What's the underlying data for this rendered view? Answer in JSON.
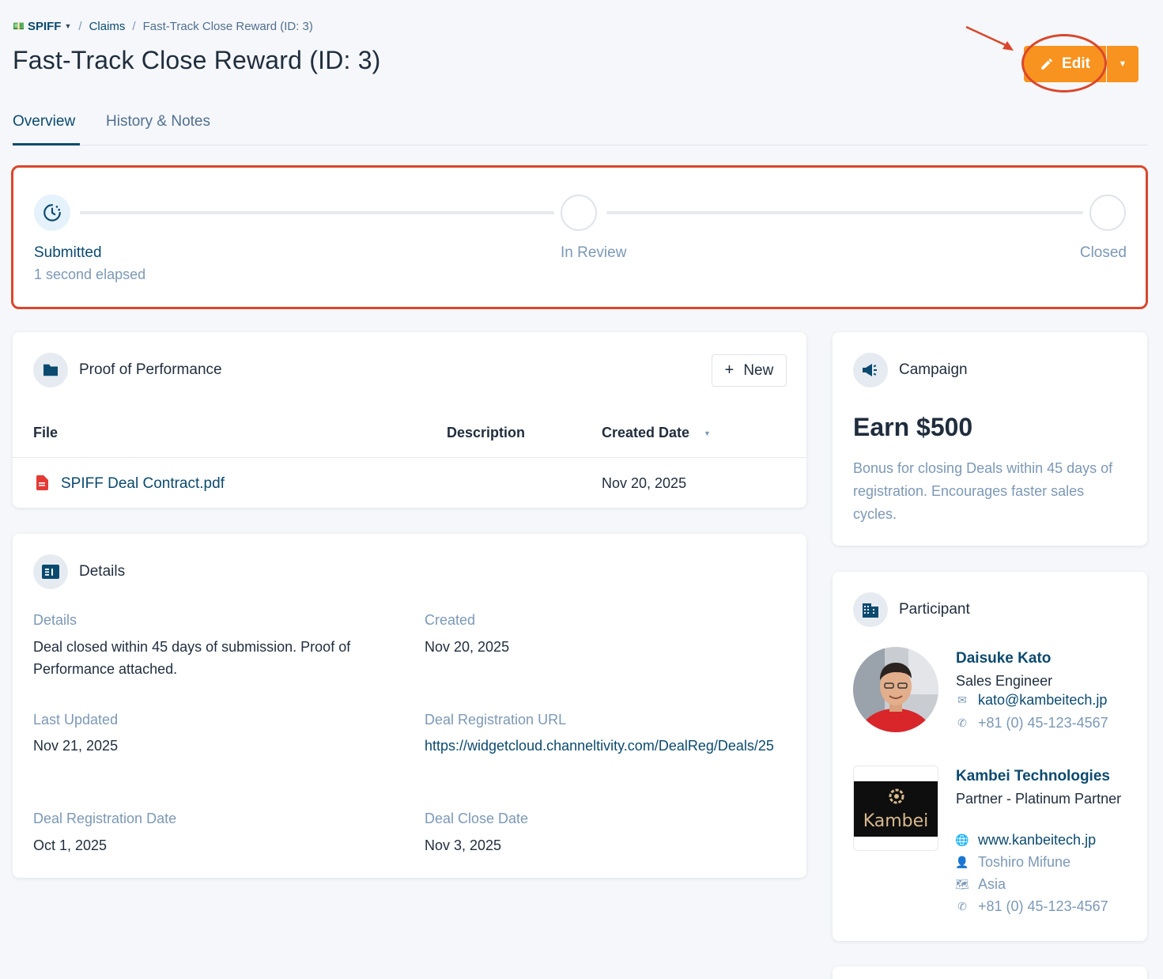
{
  "breadcrumb": {
    "root": "SPIFF",
    "claims": "Claims",
    "current": "Fast-Track Close Reward (ID: 3)"
  },
  "page_title": "Fast-Track Close Reward (ID: 3)",
  "actions": {
    "edit_label": "Edit"
  },
  "tabs": [
    "Overview",
    "History & Notes"
  ],
  "stepper": {
    "steps": [
      {
        "label": "Submitted",
        "sub": "1 second elapsed",
        "active": true
      },
      {
        "label": "In Review"
      },
      {
        "label": "Closed"
      }
    ]
  },
  "proof": {
    "title": "Proof of Performance",
    "new_label": "New",
    "columns": [
      "File",
      "Description",
      "Created Date"
    ],
    "rows": [
      {
        "file": "SPIFF Deal Contract.pdf",
        "description": "",
        "created": "Nov 20, 2025"
      }
    ]
  },
  "details": {
    "title": "Details",
    "fields": {
      "details_label": "Details",
      "details_value": "Deal closed within 45 days of submission. Proof of Performance attached.",
      "created_label": "Created",
      "created_value": "Nov 20, 2025",
      "updated_label": "Last Updated",
      "updated_value": "Nov 21, 2025",
      "url_label": "Deal Registration URL",
      "url_value": "https://widgetcloud.channeltivity.com/DealReg/Deals/25",
      "reg_date_label": "Deal Registration Date",
      "reg_date_value": "Oct 1, 2025",
      "close_date_label": "Deal Close Date",
      "close_date_value": "Nov 3, 2025"
    }
  },
  "campaign": {
    "title": "Campaign",
    "headline": "Earn $500",
    "description": "Bonus for closing Deals within 45 days of registration. Encourages faster sales cycles."
  },
  "participant": {
    "title": "Participant",
    "person": {
      "name": "Daisuke Kato",
      "role": "Sales Engineer",
      "email": "kato@kambeitech.jp",
      "phone": "+81 (0) 45-123-4567"
    },
    "company": {
      "name": "Kambei Technologies",
      "tier": "Partner - Platinum Partner",
      "logo_text": "Kambei",
      "website": "www.kanbeitech.jp",
      "contact": "Toshiro Mifune",
      "region": "Asia",
      "phone": "+81 (0) 45-123-4567"
    }
  },
  "colors": {
    "accent_orange": "#f7931e",
    "highlight_red": "#d9472d",
    "brand_navy": "#0b4a6f"
  }
}
